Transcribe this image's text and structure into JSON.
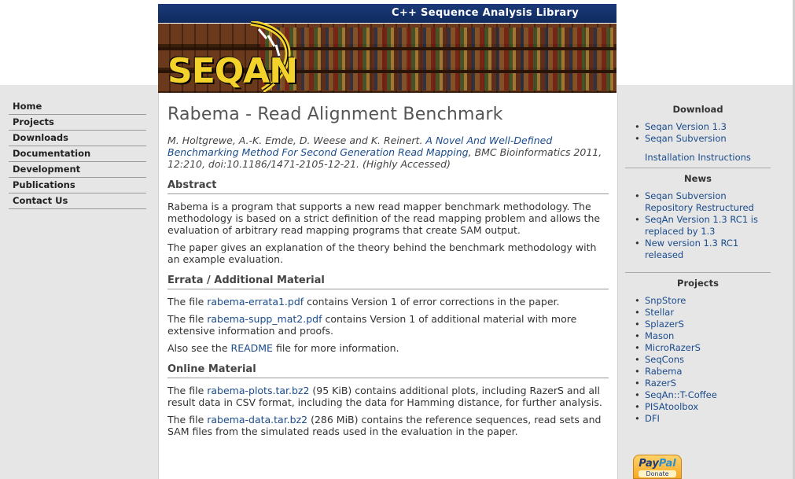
{
  "banner": {
    "subtitle": "C++ Sequence Analysis Library",
    "logo": "SEQAN"
  },
  "left_nav": {
    "items": [
      {
        "label": "Home"
      },
      {
        "label": "Projects"
      },
      {
        "label": "Downloads"
      },
      {
        "label": "Documentation"
      },
      {
        "label": "Development"
      },
      {
        "label": "Publications"
      },
      {
        "label": "Contact Us"
      }
    ]
  },
  "main": {
    "title": "Rabema - Read Alignment Benchmark",
    "citation": {
      "authors": "M. Holtgrewe, A.-K. Emde, D. Weese and K. Reinert.",
      "paper_link": "A Novel And Well-Defined Benchmarking Method For Second Generation Read Mapping",
      "rest": ", BMC Bioinformatics 2011, 12:210, doi:10.1186/1471-2105-12-21. (Highly Accessed)"
    },
    "abstract": {
      "heading": "Abstract",
      "p1": "Rabema is a program that supports a new read mapper benchmark methodology. The methodology is based on a strict definition of the read mapping problem and allows the evaluation of arbitrary read mapping programs that create SAM output.",
      "p2": "The paper gives an explanation of the theory behind the benchmark methodology with an example evaluation."
    },
    "errata": {
      "heading": "Errata / Additional Material",
      "p1_pre": "The file ",
      "p1_link": "rabema-errata1.pdf",
      "p1_post": " contains Version 1 of error corrections in the paper.",
      "p2_pre": "The file ",
      "p2_link": "rabema-supp_mat2.pdf",
      "p2_post": " contains Version 1 of additional material with more extensive information and proofs.",
      "p3_pre": "Also see the ",
      "p3_link": "README",
      "p3_post": " file for more information."
    },
    "online": {
      "heading": "Online Material",
      "p1_pre": "The file ",
      "p1_link": "rabema-plots.tar.bz2",
      "p1_post": " (95 KiB) contains additional plots, including RazerS and all result data in CSV format, including the data for Hamming distance, for further analysis.",
      "p2_pre": "The file ",
      "p2_link": "rabema-data.tar.bz2",
      "p2_post": " (286 MiB) contains the reference sequences, read sets and SAM files from the simulated reads used in the evaluation in the paper."
    }
  },
  "sidebar": {
    "download": {
      "heading": "Download",
      "items": [
        "Seqan Version 1.3",
        "Seqan Subversion"
      ],
      "extra": "Installation Instructions"
    },
    "news": {
      "heading": "News",
      "items": [
        "Seqan Subversion Repository Restructured",
        "SeqAn Version 1.3 RC1 is replaced by 1.3",
        "New version 1.3 RC1 released"
      ]
    },
    "projects": {
      "heading": "Projects",
      "items": [
        "SnpStore",
        "Stellar",
        "SplazerS",
        "Mason",
        "MicroRazerS",
        "SeqCons",
        "Rabema",
        "RazerS",
        "SeqAn::T-Coffee",
        "PISAtoolbox",
        "DFI"
      ]
    },
    "paypal": {
      "logo_a": "Pay",
      "logo_b": "Pal",
      "button": "Donate"
    }
  }
}
